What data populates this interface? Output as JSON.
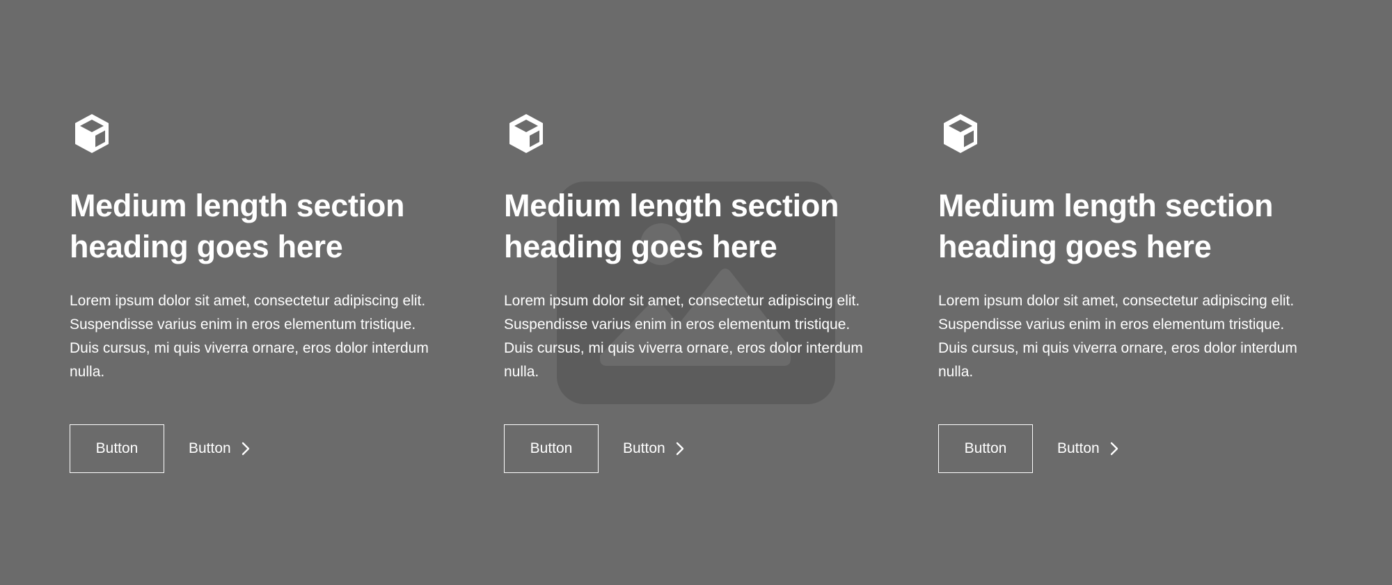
{
  "background_color": "#6b6b6b",
  "placeholder_color": "#5c5c5c",
  "features": [
    {
      "icon": "cube-icon",
      "heading": "Medium length section heading goes here",
      "body": "Lorem ipsum dolor sit amet, consectetur adipiscing elit. Suspendisse varius enim in eros elementum tristique. Duis cursus, mi quis viverra ornare, eros dolor interdum nulla.",
      "primary_button": "Button",
      "secondary_button": "Button"
    },
    {
      "icon": "cube-icon",
      "heading": "Medium length section heading goes here",
      "body": "Lorem ipsum dolor sit amet, consectetur adipiscing elit. Suspendisse varius enim in eros elementum tristique. Duis cursus, mi quis viverra ornare, eros dolor interdum nulla.",
      "primary_button": "Button",
      "secondary_button": "Button"
    },
    {
      "icon": "cube-icon",
      "heading": "Medium length section heading goes here",
      "body": "Lorem ipsum dolor sit amet, consectetur adipiscing elit. Suspendisse varius enim in eros elementum tristique. Duis cursus, mi quis viverra ornare, eros dolor interdum nulla.",
      "primary_button": "Button",
      "secondary_button": "Button"
    }
  ]
}
